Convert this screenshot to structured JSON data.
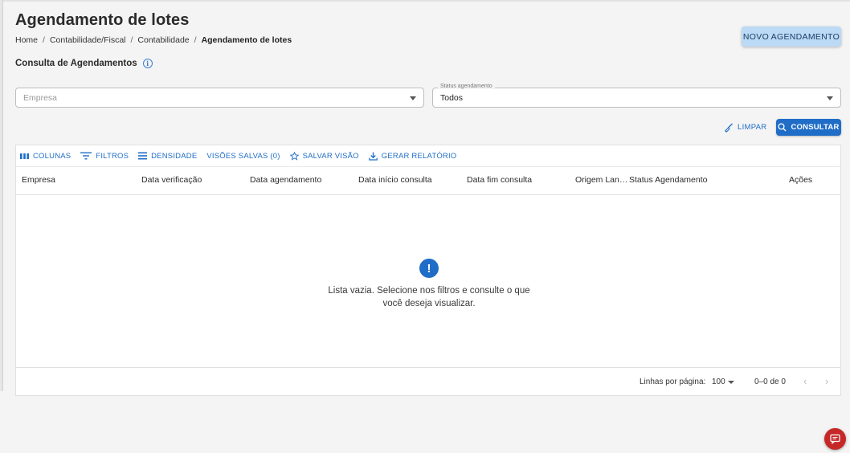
{
  "page": {
    "title": "Agendamento de lotes",
    "breadcrumb": [
      "Home",
      "Contabilidade/Fiscal",
      "Contabilidade",
      "Agendamento de lotes"
    ],
    "new_button": "NOVO AGENDAMENTO",
    "section_title": "Consulta de Agendamentos",
    "info_glyph": "i"
  },
  "filters": {
    "empresa": {
      "placeholder": "Empresa",
      "value": ""
    },
    "status": {
      "label": "Status agendamento",
      "value": "Todos"
    },
    "clear_label": "LIMPAR",
    "search_label": "CONSULTAR"
  },
  "grid": {
    "toolbar": {
      "columns": "COLUNAS",
      "filters": "FILTROS",
      "density": "DENSIDADE",
      "saved_views": "VISÕES SALVAS (0)",
      "save_view": "SALVAR VISÃO",
      "report": "GERAR RELATÓRIO"
    },
    "columns": [
      "Empresa",
      "Data verificação",
      "Data agendamento",
      "Data início consulta",
      "Data fim consulta",
      "Origem Lan…",
      "Status Agendamento",
      "Ações"
    ],
    "empty": {
      "glyph": "!",
      "line1": "Lista vazia. Selecione nos filtros e consulte o que",
      "line2": "você deseja visualizar."
    },
    "footer": {
      "rows_label": "Linhas por página:",
      "rows_value": "100",
      "range": "0–0 de 0",
      "prev": "‹",
      "next": "›"
    }
  },
  "colors": {
    "accent": "#1f6dc7",
    "button_light": "#bcd9f5",
    "chat": "#c62828"
  },
  "icons": [
    "info-icon",
    "chevron-down-icon",
    "broom-icon",
    "search-icon",
    "columns-icon",
    "filter-icon",
    "density-icon",
    "star-icon",
    "download-icon",
    "alert-icon",
    "chat-icon"
  ]
}
